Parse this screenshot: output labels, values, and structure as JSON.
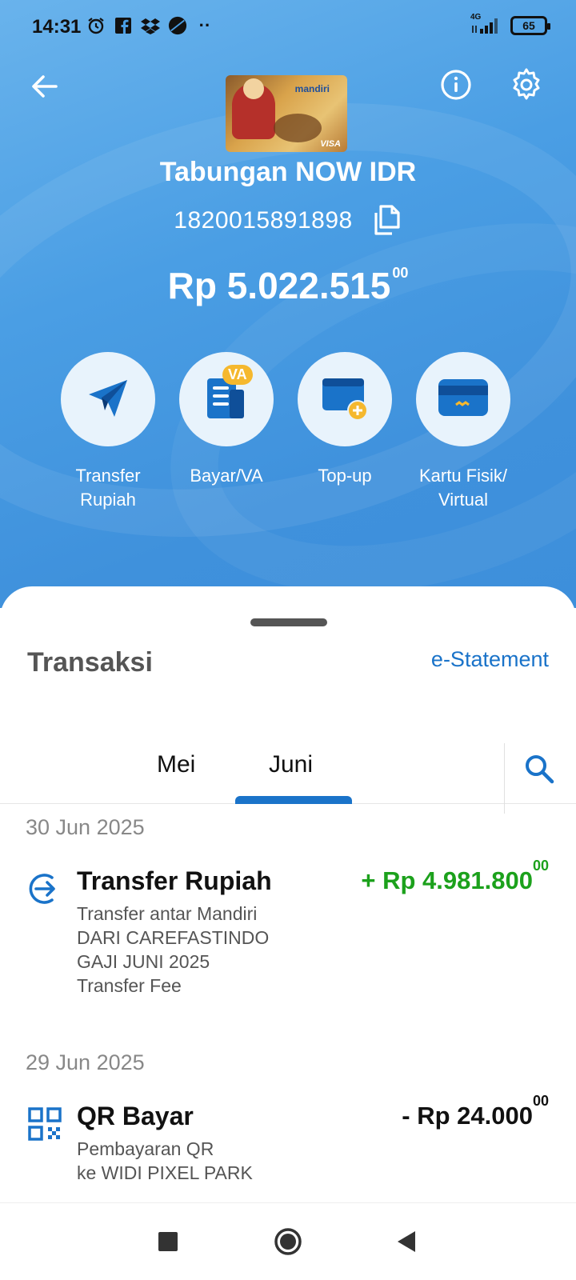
{
  "status_bar": {
    "time": "14:31",
    "network": "4G",
    "battery": "65",
    "icons": [
      "alarm-icon",
      "facebook-icon",
      "dropbox-icon",
      "circle-app-icon",
      "more-dots-icon"
    ]
  },
  "header": {
    "back_icon": "arrow-left-icon",
    "info_icon": "info-icon",
    "settings_icon": "gear-icon",
    "card_brand": "mandiri",
    "card_network": "VISA",
    "account_name": "Tabungan NOW IDR",
    "account_number": "1820015891898",
    "copy_icon": "copy-icon",
    "balance_main": "Rp 5.022.515",
    "balance_decimals": "00"
  },
  "actions": [
    {
      "label": "Transfer\nRupiah",
      "icon": "send-plane-icon"
    },
    {
      "label": "Bayar/VA",
      "icon": "bill-va-icon",
      "badge": "VA"
    },
    {
      "label": "Top-up",
      "icon": "wallet-add-icon"
    },
    {
      "label": "Kartu Fisik/\nVirtual",
      "icon": "card-icon"
    }
  ],
  "transactions_panel": {
    "title": "Transaksi",
    "estatement_link": "e-Statement",
    "tabs": [
      "Mei",
      "Juni"
    ],
    "active_tab": "Juni",
    "groups": [
      {
        "date": "30 Jun 2025",
        "items": [
          {
            "title": "Transfer Rupiah",
            "amount_main": "+ Rp 4.981.800",
            "amount_decimals": "00",
            "direction": "in",
            "icon": "transfer-in-icon",
            "description": [
              "Transfer antar Mandiri",
              "DARI CAREFASTINDO",
              "GAJI JUNI 2025",
              "Transfer Fee"
            ]
          }
        ]
      },
      {
        "date": "29 Jun 2025",
        "items": [
          {
            "title": "QR Bayar",
            "amount_main": "- Rp 24.000",
            "amount_decimals": "00",
            "direction": "out",
            "icon": "qr-code-icon",
            "description": [
              "Pembayaran QR",
              "ke WIDI PIXEL PARK"
            ]
          }
        ]
      }
    ]
  },
  "colors": {
    "primary_blue": "#1a73c9",
    "income_green": "#1ca11c",
    "header_blue": "#4a9ee4"
  }
}
